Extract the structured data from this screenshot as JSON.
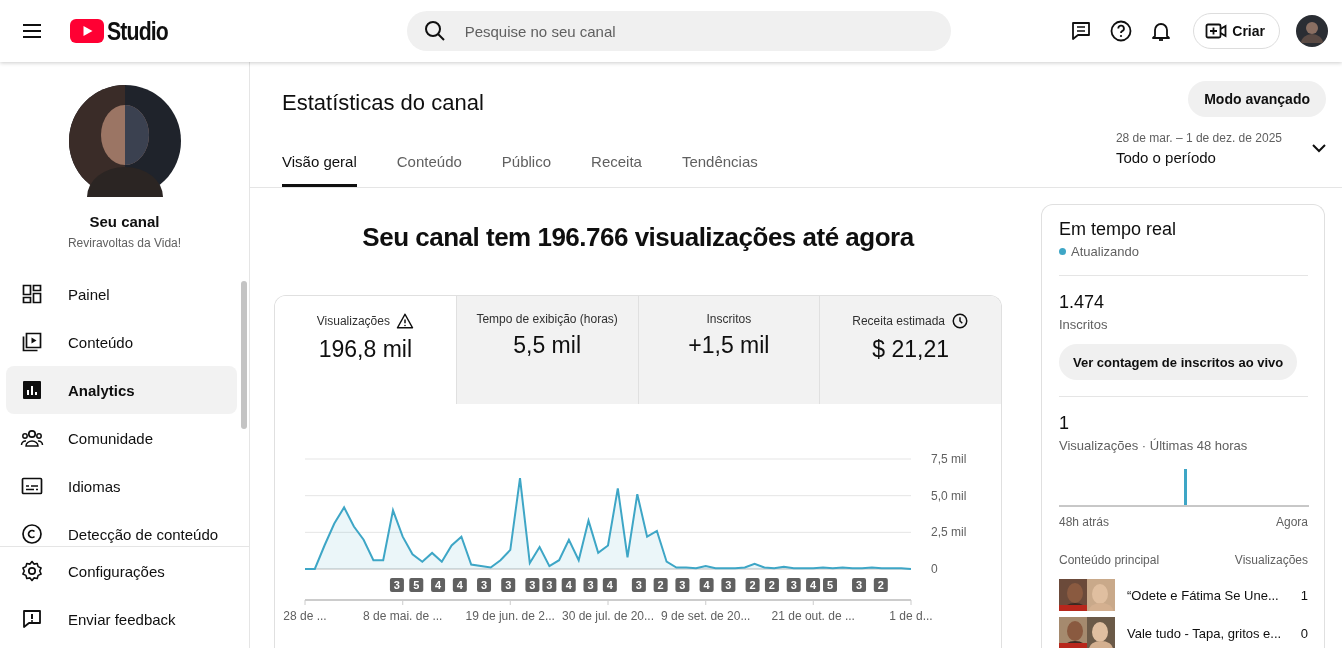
{
  "header": {
    "logo_text": "Studio",
    "search": {
      "placeholder": "Pesquise no seu canal"
    },
    "create_button": "Criar"
  },
  "sidebar": {
    "channel_label": "Seu canal",
    "channel_name": "Reviravoltas da Vida!",
    "items": [
      {
        "label": "Painel",
        "selected": false
      },
      {
        "label": "Conteúdo",
        "selected": false
      },
      {
        "label": "Analytics",
        "selected": true
      },
      {
        "label": "Comunidade",
        "selected": false
      },
      {
        "label": "Idiomas",
        "selected": false
      },
      {
        "label": "Detecção de conteúdo",
        "selected": false
      }
    ],
    "bottom_items": [
      {
        "label": "Configurações"
      },
      {
        "label": "Enviar feedback"
      }
    ]
  },
  "page": {
    "title": "Estatísticas do canal",
    "advanced_button": "Modo avançado",
    "date_range": "28 de mar. – 1 de dez. de 2025",
    "period": "Todo o período",
    "tabs": [
      {
        "label": "Visão geral",
        "selected": true
      },
      {
        "label": "Conteúdo",
        "selected": false
      },
      {
        "label": "Público",
        "selected": false
      },
      {
        "label": "Receita",
        "selected": false
      },
      {
        "label": "Tendências",
        "selected": false
      }
    ]
  },
  "overview": {
    "headline": "Seu canal tem 196.766 visualizações até agora",
    "metrics": [
      {
        "label": "Visualizações",
        "value": "196,8 mil",
        "selected": true,
        "kind": "warning"
      },
      {
        "label": "Tempo de exibição (horas)",
        "value": "5,5 mil",
        "selected": false,
        "kind": "plain"
      },
      {
        "label": "Inscritos",
        "value": "+1,5 mil",
        "selected": false,
        "kind": "plain"
      },
      {
        "label": "Receita estimada",
        "value": "$ 21,21",
        "selected": false,
        "kind": "pending"
      }
    ],
    "chart_data": {
      "type": "area",
      "categories": [
        "28 de ...",
        null,
        null,
        null,
        null,
        null,
        null,
        null,
        null,
        null,
        "8 de mai. de ...",
        null,
        null,
        null,
        null,
        null,
        null,
        null,
        null,
        null,
        null,
        "19 de jun. de 2...",
        null,
        null,
        null,
        null,
        null,
        null,
        null,
        null,
        null,
        "30 de jul. de 20...",
        null,
        null,
        null,
        null,
        null,
        null,
        null,
        null,
        null,
        "9 de set. de 20...",
        null,
        null,
        null,
        null,
        null,
        null,
        null,
        null,
        null,
        null,
        "21 de out. de ...",
        null,
        null,
        null,
        null,
        null,
        null,
        null,
        null,
        null,
        "1 de d..."
      ],
      "series": [
        {
          "color": "#3ea6c6",
          "values": [
            0,
            0,
            1.6,
            3.1,
            4.2,
            2.9,
            2.0,
            0.6,
            0.6,
            4.0,
            2.2,
            1.0,
            0.5,
            1.1,
            0.5,
            1.6,
            2.2,
            0.3,
            0.2,
            0.1,
            0.6,
            1.3,
            6.2,
            0.4,
            1.5,
            0.2,
            0.6,
            2.0,
            0.6,
            3.3,
            1.1,
            1.6,
            5.5,
            0.8,
            5.1,
            2.2,
            2.6,
            0.5,
            0.1,
            0.1,
            0.05,
            0.2,
            0.05,
            0.05,
            0.05,
            0.1,
            0.35,
            0.1,
            0.05,
            0.15,
            0.05,
            0.05,
            0.05,
            0.1,
            0.05,
            0.1,
            0.05,
            0.05,
            0.1,
            0.05,
            0.05,
            0.05,
            0
          ]
        }
      ],
      "ylim": [
        0,
        7.5
      ],
      "yticks": [
        {
          "value": 0,
          "label": "0"
        },
        {
          "value": 2.5,
          "label": "2,5 mil"
        },
        {
          "value": 5,
          "label": "5,0 mil"
        },
        {
          "value": 7.5,
          "label": "7,5 mil"
        }
      ],
      "annotations": [
        "3",
        "5",
        "4",
        "4",
        "3",
        "3",
        "3",
        "3",
        "4",
        "3",
        "4",
        "3",
        "2",
        "3",
        "4",
        "3",
        "2",
        "2",
        "3",
        "4",
        "5",
        "3",
        "2"
      ]
    }
  },
  "realtime": {
    "title": "Em tempo real",
    "status": "Atualizando",
    "subscribers": "1.474",
    "subscribers_label": "Inscritos",
    "live_button": "Ver contagem de inscritos ao vivo",
    "views": "1",
    "views_label": "Visualizações · Últimas 48 horas",
    "axis_start": "48h atrás",
    "axis_end": "Agora",
    "top_content_label": "Conteúdo principal",
    "top_views_label": "Visualizações",
    "top_content": [
      {
        "kind": "picture",
        "title": "“Odete e Fátima Se Une...",
        "views": "1"
      },
      {
        "kind": "picture",
        "title": "Vale tudo - Tapa, gritos e...",
        "views": "0"
      }
    ]
  }
}
